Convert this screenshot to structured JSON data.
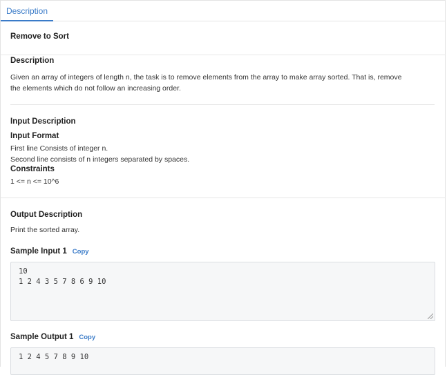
{
  "tabs": [
    {
      "label": "Description",
      "active": true
    }
  ],
  "problem": {
    "title": "Remove to Sort"
  },
  "description": {
    "heading": "Description",
    "lines": [
      "Given an array of integers of length n, the task is to remove elements from the array to make array sorted. That is, remove",
      "the elements which do not follow an increasing order."
    ]
  },
  "input": {
    "heading": "Input Description",
    "format_heading": "Input Format",
    "format_lines": [
      "First line Consists of integer n.",
      "Second line consists of n integers separated by spaces."
    ],
    "constraints_heading": "Constraints",
    "constraints_lines": [
      "1 <= n <= 10^6"
    ]
  },
  "output": {
    "heading": "Output Description",
    "text": "Print the sorted array."
  },
  "samples": {
    "input_label": "Sample Input 1",
    "input_copy": "Copy",
    "input_lines": [
      "10",
      "1 2 4 3 5 7 8 6 9 10"
    ],
    "output_label": "Sample Output 1",
    "output_copy": "Copy",
    "output_lines": [
      "1 2 4 5 7 8 9 10"
    ]
  },
  "colors": {
    "accent": "#3a7bc8",
    "divider": "#e6e6e6",
    "sample_bg": "#f6f7f8"
  }
}
